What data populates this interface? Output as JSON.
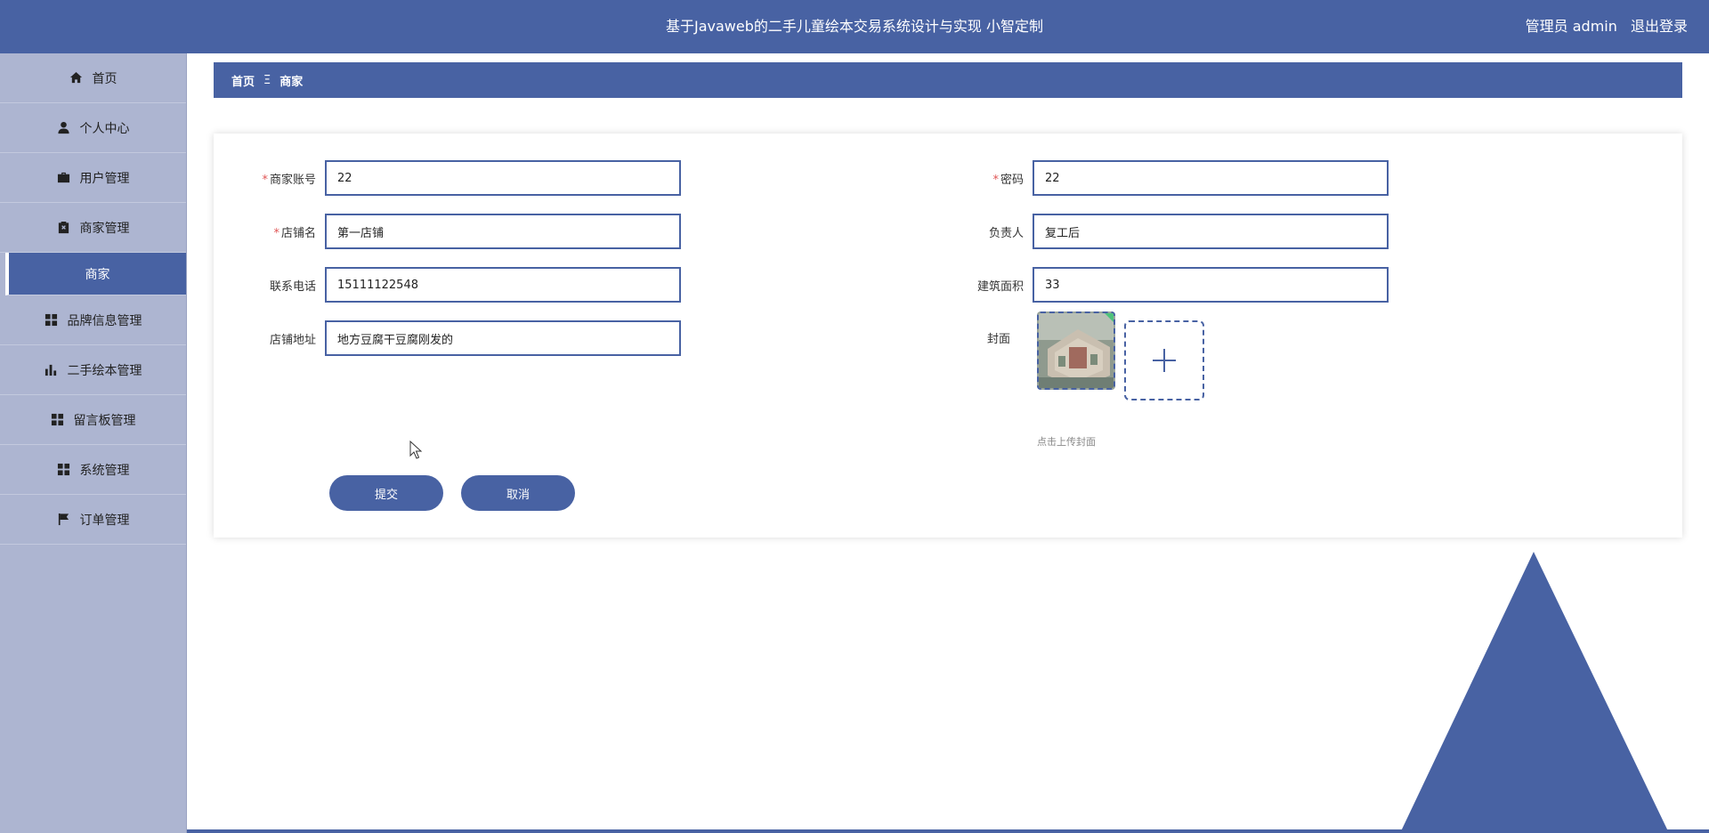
{
  "header": {
    "title": "基于Javaweb的二手儿童绘本交易系统设计与实现 小智定制",
    "user_label": "管理员 admin",
    "logout_label": "退出登录"
  },
  "sidebar": {
    "items": [
      {
        "label": "首页",
        "icon": "home-icon"
      },
      {
        "label": "个人中心",
        "icon": "user-icon"
      },
      {
        "label": "用户管理",
        "icon": "briefcase-icon"
      },
      {
        "label": "商家管理",
        "icon": "clipboard-icon"
      },
      {
        "label": "商家",
        "icon": ""
      },
      {
        "label": "品牌信息管理",
        "icon": "grid-icon"
      },
      {
        "label": "二手绘本管理",
        "icon": "bar-chart-icon"
      },
      {
        "label": "留言板管理",
        "icon": "grid-icon"
      },
      {
        "label": "系统管理",
        "icon": "grid-icon"
      },
      {
        "label": "订单管理",
        "icon": "flag-icon"
      }
    ]
  },
  "breadcrumb": {
    "home": "首页",
    "separator": "Ξ",
    "current": "商家"
  },
  "form": {
    "account": {
      "label": "商家账号",
      "value": "22",
      "required": true
    },
    "password": {
      "label": "密码",
      "value": "22",
      "required": true
    },
    "shop_name": {
      "label": "店铺名",
      "value": "第一店铺",
      "required": true
    },
    "manager": {
      "label": "负责人",
      "value": "复工后",
      "required": false
    },
    "phone": {
      "label": "联系电话",
      "value": "15111122548",
      "required": false
    },
    "area": {
      "label": "建筑面积",
      "value": "33",
      "required": false
    },
    "address": {
      "label": "店铺地址",
      "value": "地方豆腐干豆腐刚发的",
      "required": false
    },
    "cover": {
      "label": "封面",
      "hint": "点击上传封面"
    },
    "submit_label": "提交",
    "cancel_label": "取消"
  },
  "colors": {
    "primary": "#4862a3",
    "sidebar": "#adb5d1",
    "required": "#e05555"
  }
}
